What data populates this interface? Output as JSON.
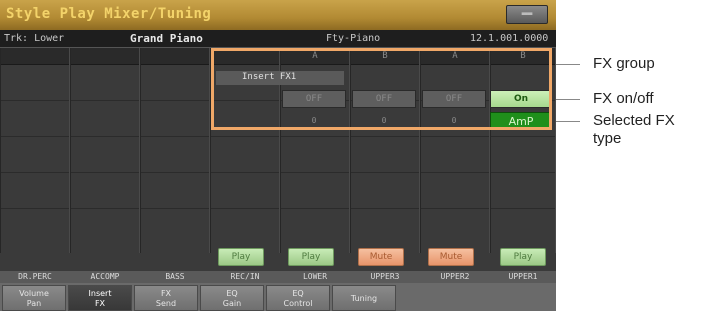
{
  "title": "Style Play Mixer/Tuning",
  "title_button": "▬▬",
  "track": {
    "track_label": "Trk: Lower",
    "sound_name": "Grand Piano",
    "category": "Fty-Piano",
    "bank_number": "12.1.001.0000"
  },
  "columns": {
    "headers": [
      "",
      "",
      "",
      "",
      "A",
      "B",
      "A",
      "B"
    ]
  },
  "insert_fx_label": "Insert FX1",
  "fx_onoff": [
    "OFF",
    "OFF",
    "OFF",
    "On"
  ],
  "fx_types": [
    "0",
    "0",
    "0",
    "AmP"
  ],
  "play_buttons": [
    "Play",
    "Play",
    "Mute",
    "Mute",
    "Play"
  ],
  "channel_labels": [
    "DR.PERC",
    "ACCOMP",
    "BASS",
    "REC/IN",
    "LOWER",
    "UPPER3",
    "UPPER2",
    "UPPER1"
  ],
  "tabs": [
    {
      "label": "Volume\nPan"
    },
    {
      "label": "Insert\nFX"
    },
    {
      "label": "FX\nSend"
    },
    {
      "label": "EQ\nGain"
    },
    {
      "label": "EQ\nControl"
    },
    {
      "label": "Tuning"
    }
  ],
  "callouts": {
    "fx_group": "FX group",
    "fx_onoff": "FX on/off",
    "selected_fx": "Selected FX type"
  },
  "colors": {
    "accent_orange": "#f0a868",
    "on_green": "#a6d98e",
    "selected_green": "#1f8f1b"
  }
}
